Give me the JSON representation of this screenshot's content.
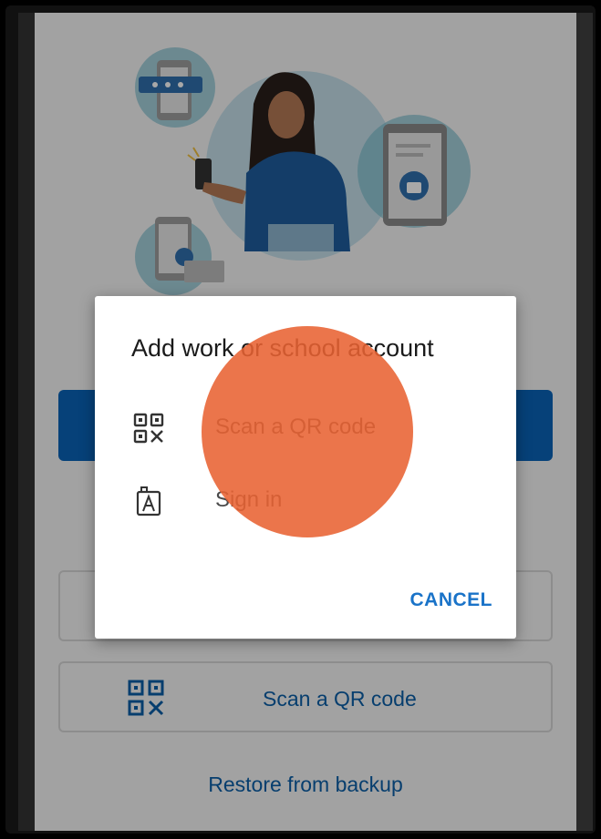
{
  "dialog": {
    "title": "Add work or school account",
    "options": [
      {
        "label": "Scan a QR code",
        "icon": "qr-code-icon"
      },
      {
        "label": "Sign in",
        "icon": "id-badge-icon"
      }
    ],
    "cancel_label": "CANCEL"
  },
  "background": {
    "scan_qr_label": "Scan a QR code",
    "restore_label": "Restore from backup"
  },
  "colors": {
    "accent_blue": "#0a63b8",
    "tap_highlight": "#e86232",
    "dialog_bg": "#ffffff"
  }
}
